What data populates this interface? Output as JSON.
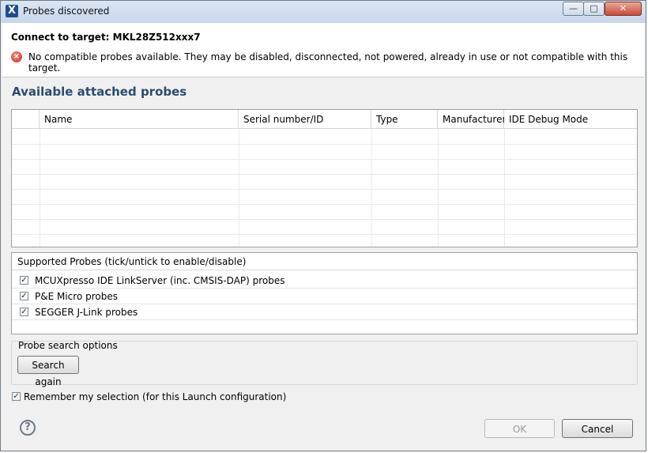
{
  "window": {
    "title": "Probes discovered",
    "app_icon": "X",
    "controls": {
      "minimize": "—",
      "maximize": "□",
      "close": "✕"
    }
  },
  "header": {
    "connect_title": "Connect to target: MKL28Z512xxx7",
    "error_icon": "error-icon",
    "error_text": "No compatible probes available. They may be disabled, disconnected, not powered, already in use or not compatible with this target."
  },
  "section_title": "Available attached probes",
  "probes_table": {
    "columns": [
      "Name",
      "Serial number/ID",
      "Type",
      "Manufacturer",
      "IDE Debug Mode"
    ],
    "rows": []
  },
  "supported_probes": {
    "header": "Supported Probes (tick/untick to enable/disable)",
    "items": [
      {
        "label": "MCUXpresso IDE LinkServer (inc. CMSIS-DAP) probes",
        "checked": true
      },
      {
        "label": "P&E Micro probes",
        "checked": true
      },
      {
        "label": "SEGGER J-Link probes",
        "checked": true
      }
    ]
  },
  "search_options": {
    "legend": "Probe search options",
    "button": "Search again"
  },
  "remember": {
    "label": "Remember my selection (for this Launch configuration)",
    "checked": true
  },
  "footer": {
    "ok": "OK",
    "cancel": "Cancel",
    "help_icon": "?"
  }
}
